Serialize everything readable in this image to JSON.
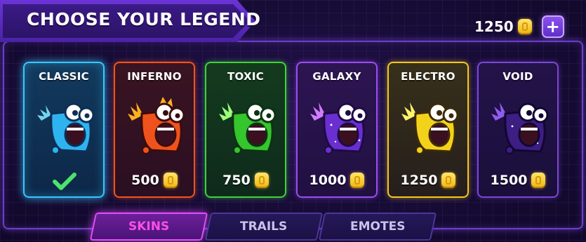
{
  "header": {
    "title": "CHOOSE YOUR LEGEND"
  },
  "currency": {
    "amount": "1250",
    "icon": "coin-icon",
    "add_label": "+"
  },
  "skins": [
    {
      "id": "classic",
      "name": "CLASSIC",
      "status": "owned",
      "color": "#35c9ff"
    },
    {
      "id": "inferno",
      "name": "INFERNO",
      "price": "500",
      "color": "#f2541d"
    },
    {
      "id": "toxic",
      "name": "TOXIC",
      "price": "750",
      "color": "#3fd33a"
    },
    {
      "id": "galaxy",
      "name": "GALAXY",
      "price": "1000",
      "color": "#9b4df0"
    },
    {
      "id": "electro",
      "name": "ELECTRO",
      "price": "1250",
      "color": "#f5c81c"
    },
    {
      "id": "void",
      "name": "VOID",
      "price": "1500",
      "color": "#7b46d8"
    }
  ],
  "tabs": [
    {
      "label": "SKINS",
      "active": true
    },
    {
      "label": "TRAILS",
      "active": false
    },
    {
      "label": "EMOTES",
      "active": false
    }
  ]
}
